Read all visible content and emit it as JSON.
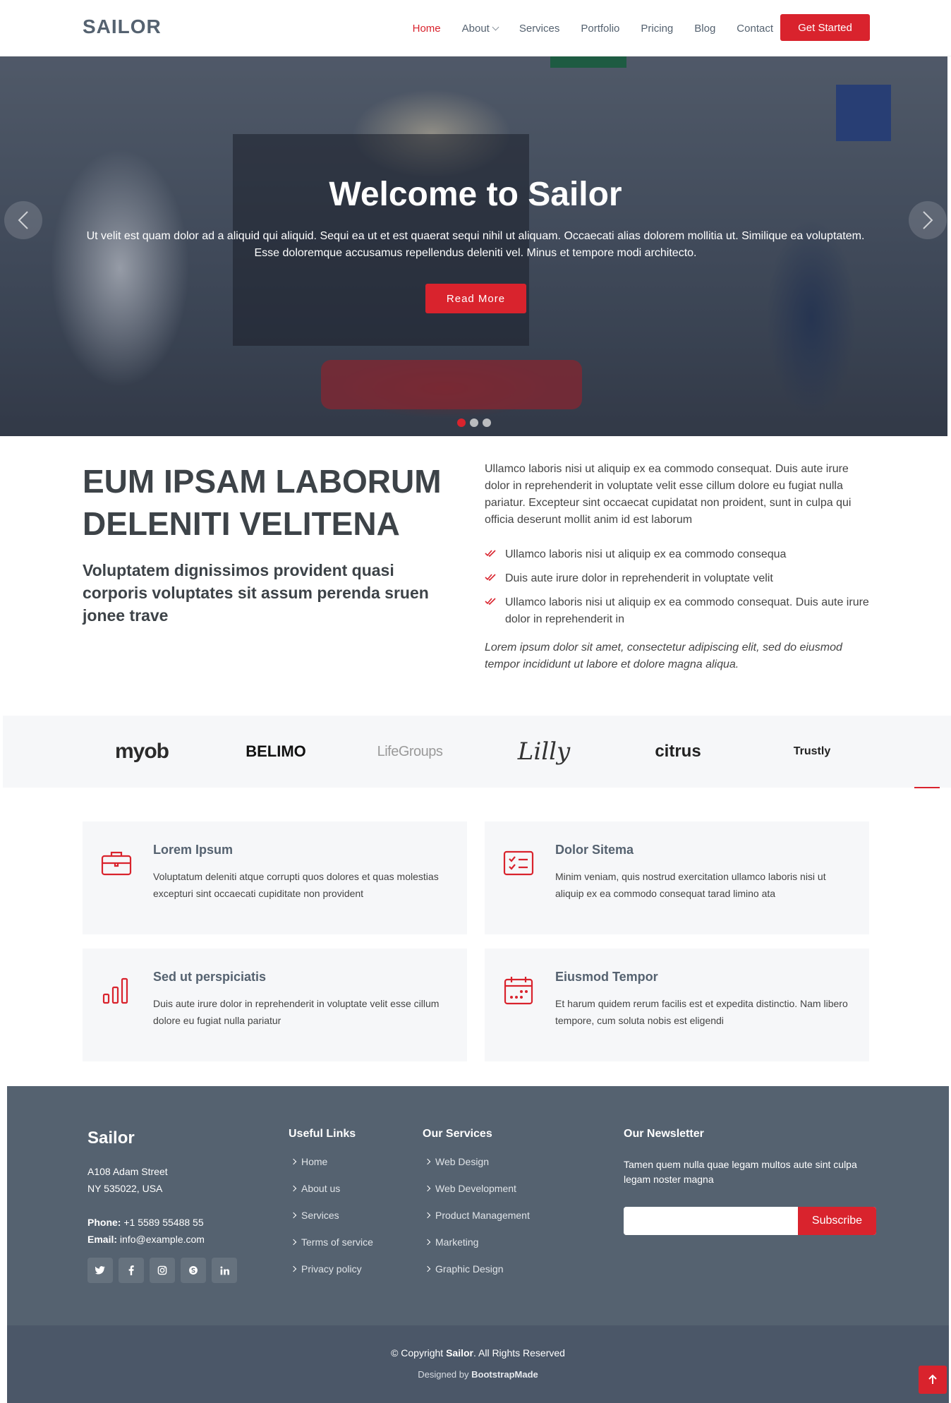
{
  "header": {
    "logo": "SAILOR",
    "nav": [
      {
        "label": "Home"
      },
      {
        "label": "About"
      },
      {
        "label": "Services"
      },
      {
        "label": "Portfolio"
      },
      {
        "label": "Pricing"
      },
      {
        "label": "Blog"
      },
      {
        "label": "Contact"
      }
    ],
    "cta": "Get Started"
  },
  "hero": {
    "title": "Welcome to Sailor",
    "text": "Ut velit est quam dolor ad a aliquid qui aliquid. Sequi ea ut et est quaerat sequi nihil ut aliquam. Occaecati alias dolorem mollitia ut. Similique ea voluptatem. Esse doloremque accusamus repellendus deleniti vel. Minus et tempore modi architecto.",
    "button": "Read More",
    "active_slide": 1,
    "slide_count": 3
  },
  "about": {
    "title": "EUM IPSAM LABORUM DELENITI VELITENA",
    "subtitle": "Voluptatem dignissimos provident quasi corporis voluptates sit assum perenda sruen jonee trave",
    "intro": "Ullamco laboris nisi ut aliquip ex ea commodo consequat. Duis aute irure dolor in reprehenderit in voluptate velit esse cillum dolore eu fugiat nulla pariatur. Excepteur sint occaecat cupidatat non proident, sunt in culpa qui officia deserunt mollit anim id est laborum",
    "list": [
      "Ullamco laboris nisi ut aliquip ex ea commodo consequa",
      "Duis aute irure dolor in reprehenderit in voluptate velit",
      "Ullamco laboris nisi ut aliquip ex ea commodo consequat. Duis aute irure dolor in reprehenderit in"
    ],
    "italic": "Lorem ipsum dolor sit amet, consectetur adipiscing elit, sed do eiusmod tempor incididunt ut labore et dolore magna aliqua."
  },
  "clients": [
    "myob",
    "BELIMO",
    "LifeGroups",
    "Lilly",
    "citrus",
    "Trustly"
  ],
  "features": [
    {
      "icon": "briefcase-icon",
      "title": "Lorem Ipsum",
      "text": "Voluptatum deleniti atque corrupti quos dolores et quas molestias excepturi sint occaecati cupiditate non provident"
    },
    {
      "icon": "card-checklist-icon",
      "title": "Dolor Sitema",
      "text": "Minim veniam, quis nostrud exercitation ullamco laboris nisi ut aliquip ex ea commodo consequat tarad limino ata"
    },
    {
      "icon": "bar-chart-icon",
      "title": "Sed ut perspiciatis",
      "text": "Duis aute irure dolor in reprehenderit in voluptate velit esse cillum dolore eu fugiat nulla pariatur"
    },
    {
      "icon": "calendar-icon",
      "title": "Eiusmod Tempor",
      "text": "Et harum quidem rerum facilis est et expedita distinctio. Nam libero tempore, cum soluta nobis est eligendi"
    }
  ],
  "footer": {
    "brand": "Sailor",
    "address_line1": "A108 Adam Street",
    "address_line2": "NY 535022, USA",
    "phone_label": "Phone:",
    "phone": "+1 5589 55488 55",
    "email_label": "Email:",
    "email": "info@example.com",
    "socials": [
      "twitter-icon",
      "facebook-icon",
      "instagram-icon",
      "skype-icon",
      "linkedin-icon"
    ],
    "useful_links": {
      "title": "Useful Links",
      "items": [
        "Home",
        "About us",
        "Services",
        "Terms of service",
        "Privacy policy"
      ]
    },
    "services": {
      "title": "Our Services",
      "items": [
        "Web Design",
        "Web Development",
        "Product Management",
        "Marketing",
        "Graphic Design"
      ]
    },
    "newsletter": {
      "title": "Our Newsletter",
      "text": "Tamen quem nulla quae legam multos aute sint culpa legam noster magna",
      "input_value": "",
      "button": "Subscribe"
    },
    "copyright_prefix": "© Copyright ",
    "copyright_brand": "Sailor",
    "copyright_suffix": ". All Rights Reserved",
    "credits_prefix": "Designed by ",
    "credits_brand": "BootstrapMade"
  },
  "colors": {
    "accent": "#d9232d",
    "text_dark": "#556270",
    "footer_bg": "#556270",
    "section_bg": "#f6f7f9"
  }
}
